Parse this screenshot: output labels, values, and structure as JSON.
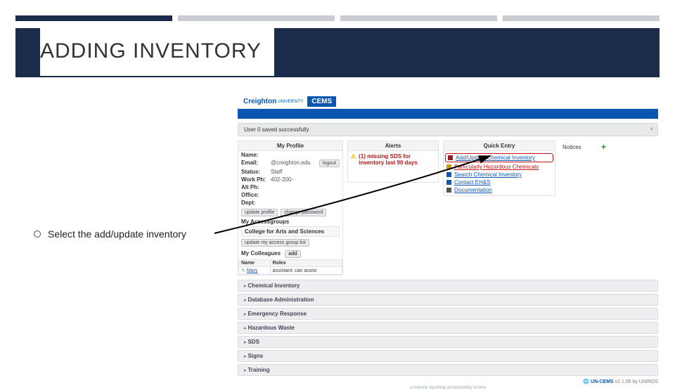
{
  "slide": {
    "title": "ADDING INVENTORY",
    "bullet": "Select the add/update inventory"
  },
  "cems": {
    "logo": {
      "name": "Creighton",
      "sub": "UNIVERSITY",
      "app": "CEMS"
    },
    "flash": "User 0 saved successfully",
    "profile": {
      "header": "My Profile",
      "name_lbl": "Name:",
      "email_lbl": "Email:",
      "email_val": "@creighton.edu",
      "status_lbl": "Status:",
      "status_val": "Staff",
      "workph_lbl": "Work Ph:",
      "workph_val": "402-200-",
      "altph_lbl": "Alt Ph:",
      "office_lbl": "Office:",
      "dept_lbl": "Dept:",
      "btn_logout": "logout",
      "btn_update": "update profile",
      "btn_changepw": "change password",
      "accessgroups_hd": "My Accessgroups",
      "accessgroup_item": "College for Arts and Sciences",
      "btn_updlist": "update my access group list",
      "colleagues_hd": "My Colleagues",
      "btn_add": "add",
      "col_name": "Name",
      "col_roles": "Roles",
      "row_name": "Mary",
      "row_role": "assistant: can assist"
    },
    "alerts": {
      "header": "Alerts",
      "msg": "(1) missing SDS for inventory last 90 days"
    },
    "quick": {
      "header": "Quick Entry",
      "items": [
        {
          "label": "Add/Update Chemical Inventory",
          "color": "#9b1c1c",
          "highlight": true
        },
        {
          "label": "Particularly Hazardous Chemicals",
          "color": "#c99a0a"
        },
        {
          "label": "Search Chemical Inventory",
          "color": "#1257b5"
        },
        {
          "label": "Contact EH&S",
          "color": "#1257b5"
        },
        {
          "label": "Documentation",
          "color": "#555"
        }
      ]
    },
    "notices": {
      "header": "Notices"
    },
    "accordion": [
      "Chemical Inventory",
      "Database Administration",
      "Emergency Response",
      "Hazardous Waste",
      "SDS",
      "Signs",
      "Training"
    ],
    "footer": {
      "product": "UN-CEMS",
      "ver": "v2.1.05 by UNIROS",
      "line2": "university reporting accountability on-line"
    }
  }
}
